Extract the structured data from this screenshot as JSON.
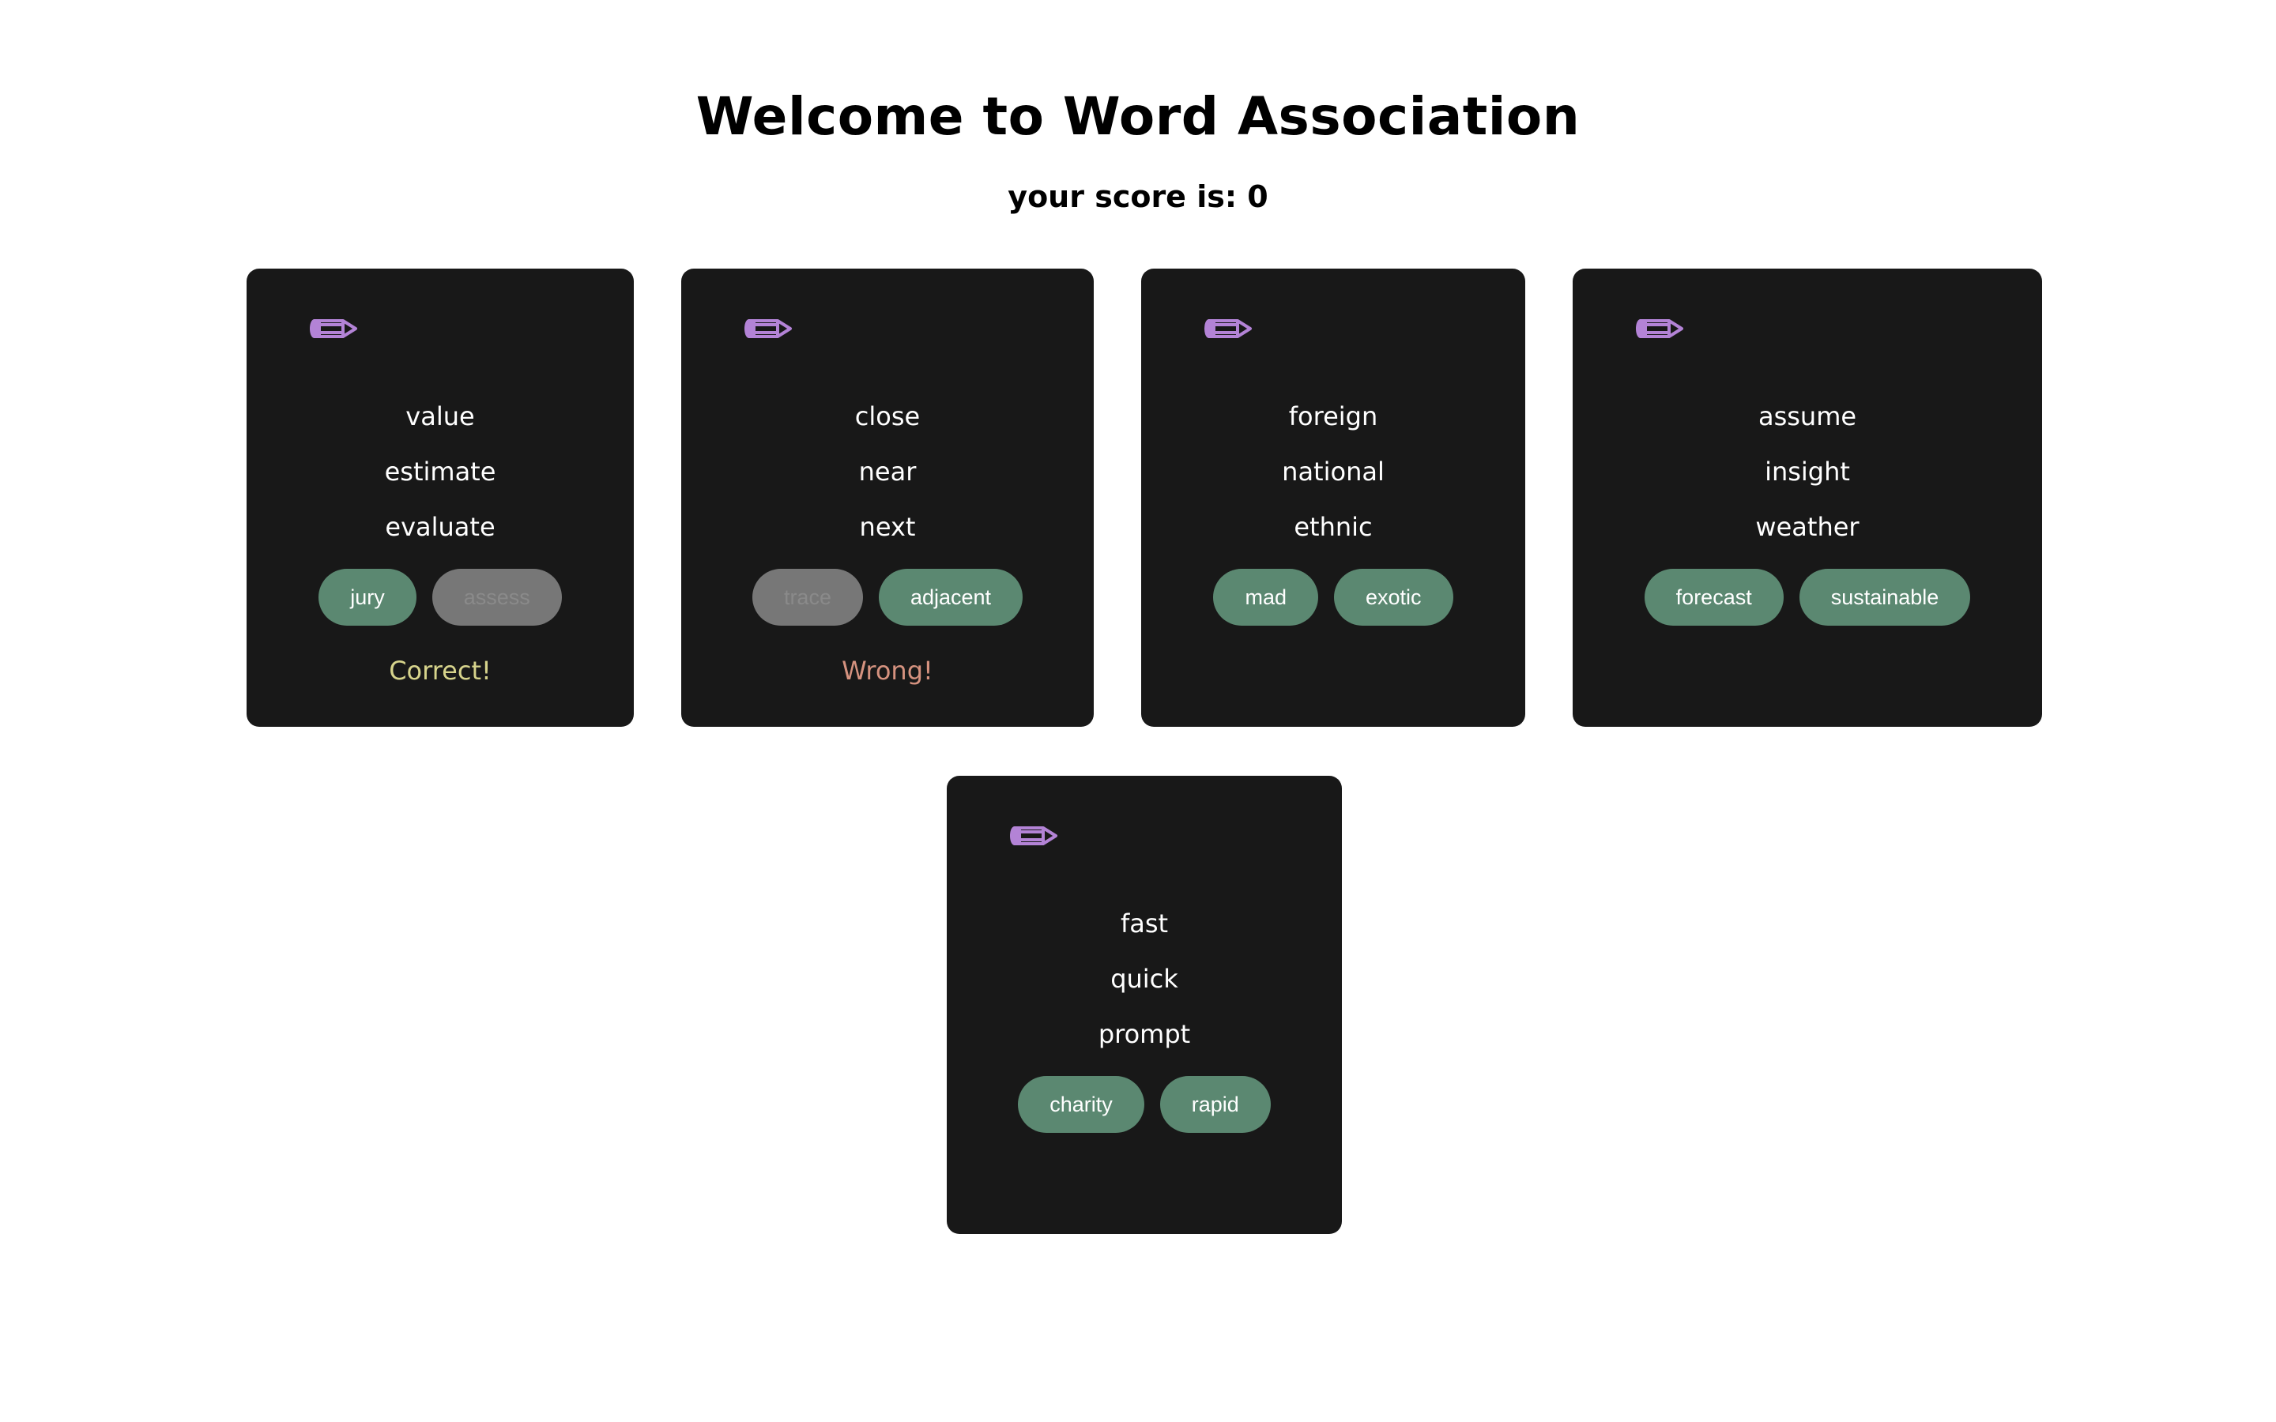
{
  "header": {
    "title": "Welcome to Word Association",
    "score_text": "your score is: 0"
  },
  "colors": {
    "card_background": "#181818",
    "choice_button": "#5b8871",
    "choice_disabled": "#777777",
    "correct_text": "#d7d48c",
    "wrong_text": "#d5927f",
    "pencil_icon": "#b383d6"
  },
  "cards": [
    {
      "icon": "pencil-icon",
      "words": [
        "value",
        "estimate",
        "evaluate"
      ],
      "choices": [
        {
          "label": "jury",
          "disabled": false
        },
        {
          "label": "assess",
          "disabled": true
        }
      ],
      "result": "Correct!"
    },
    {
      "icon": "pencil-icon",
      "words": [
        "close",
        "near",
        "next"
      ],
      "choices": [
        {
          "label": "trace",
          "disabled": true
        },
        {
          "label": "adjacent",
          "disabled": false
        }
      ],
      "result": "Wrong!"
    },
    {
      "icon": "pencil-icon",
      "words": [
        "foreign",
        "national",
        "ethnic"
      ],
      "choices": [
        {
          "label": "mad",
          "disabled": false
        },
        {
          "label": "exotic",
          "disabled": false
        }
      ],
      "result": ""
    },
    {
      "icon": "pencil-icon",
      "words": [
        "assume",
        "insight",
        "weather"
      ],
      "choices": [
        {
          "label": "forecast",
          "disabled": false
        },
        {
          "label": "sustainable",
          "disabled": false
        }
      ],
      "result": ""
    },
    {
      "icon": "pencil-icon",
      "words": [
        "fast",
        "quick",
        "prompt"
      ],
      "choices": [
        {
          "label": "charity",
          "disabled": false
        },
        {
          "label": "rapid",
          "disabled": false
        }
      ],
      "result": ""
    }
  ]
}
